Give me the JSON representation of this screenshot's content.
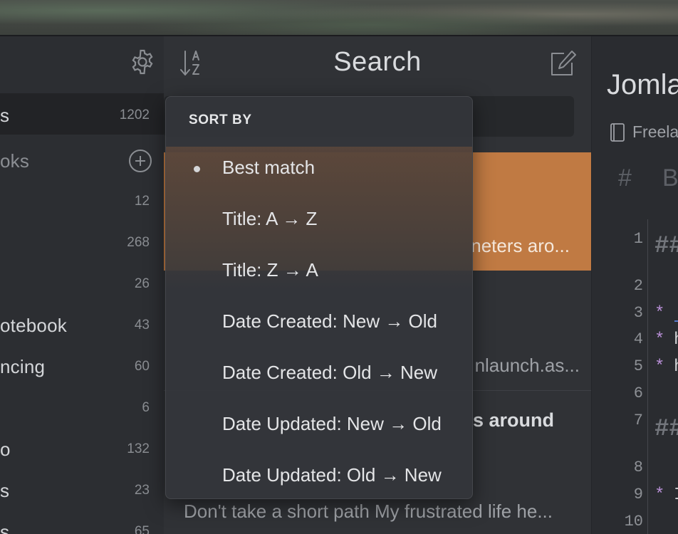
{
  "sidebar": {
    "rows": [
      {
        "label": "s",
        "count": "1202",
        "active": true
      },
      {
        "label": "oks",
        "count": "",
        "add": true
      },
      {
        "label": "",
        "count": "12"
      },
      {
        "label": "",
        "count": "268"
      },
      {
        "label": "",
        "count": "26"
      },
      {
        "label": "otebook",
        "count": "43"
      },
      {
        "label": "ncing",
        "count": "60"
      },
      {
        "label": "",
        "count": "6"
      },
      {
        "label": "o",
        "count": "132"
      },
      {
        "label": "s",
        "count": "23"
      },
      {
        "label": "s",
        "count": "65"
      }
    ]
  },
  "notelist": {
    "title": "Search",
    "selected_snippet": "neters aro...",
    "note2_snippet": "nlaunch.as...",
    "note3_title": "s around",
    "note3_snippet": "Don't take a short path My frustrated life he..."
  },
  "sort_menu": {
    "header": "SORT BY",
    "options": [
      {
        "label": "Best match",
        "selected": true
      },
      {
        "label": "Title: A → Z",
        "selected": false
      },
      {
        "label": "Title: Z → A",
        "selected": false
      },
      {
        "label": "Date Created: New → Old",
        "selected": false
      },
      {
        "label": "Date Created: Old → New",
        "selected": false
      },
      {
        "label": "Date Updated: New → Old",
        "selected": false
      },
      {
        "label": "Date Updated: Old → New",
        "selected": false
      }
    ]
  },
  "editor": {
    "title": "Jomla",
    "notebook": "Freela",
    "toolbar": {
      "heading": "#",
      "bold": "B"
    },
    "line_numbers": [
      "1",
      "2",
      "3",
      "4",
      "5",
      "6",
      "7",
      "8",
      "9",
      "10"
    ],
    "lines": [
      {
        "kind": "h",
        "text": "##"
      },
      {
        "kind": "star",
        "text": "*"
      },
      {
        "kind": "star",
        "text": "*"
      },
      {
        "kind": "star",
        "text": "*"
      },
      {
        "kind": "h",
        "text": "##"
      },
      {
        "kind": "star",
        "text": "*"
      }
    ],
    "line_text": {
      "l4": "h",
      "l5": "h",
      "l9": "I"
    }
  },
  "icons": {
    "settings": "gear-icon",
    "sort": "sort-az-icon",
    "compose": "compose-icon",
    "notebook": "book-icon",
    "add": "plus-circle-icon"
  },
  "colors": {
    "accent": "#c07a43",
    "sidebar_bg": "#2c2e32",
    "list_bg": "#303236",
    "editor_bg": "#2a2c30"
  }
}
